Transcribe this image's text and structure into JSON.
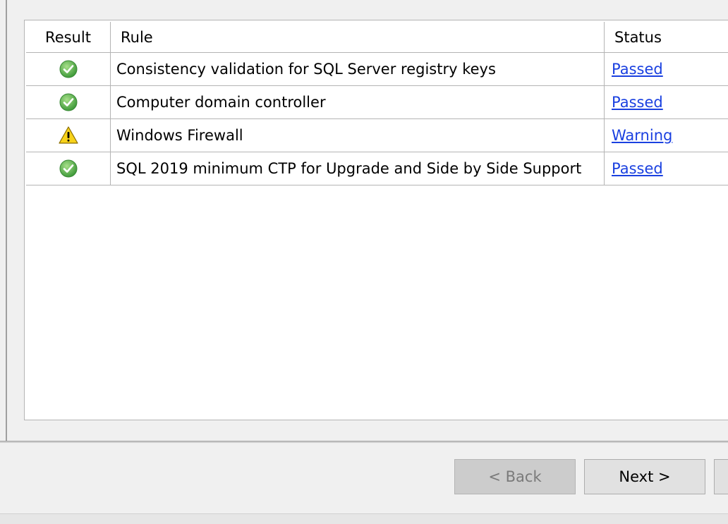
{
  "table": {
    "columns": {
      "result": "Result",
      "rule": "Rule",
      "status": "Status"
    },
    "rows": [
      {
        "result_icon": "check-icon",
        "rule": "Consistency validation for SQL Server registry keys",
        "status": "Passed"
      },
      {
        "result_icon": "check-icon",
        "rule": "Computer domain controller",
        "status": "Passed"
      },
      {
        "result_icon": "warning-icon",
        "rule": "Windows Firewall",
        "status": "Warning"
      },
      {
        "result_icon": "check-icon",
        "rule": "SQL 2019 minimum CTP for Upgrade and Side by Side Support",
        "status": "Passed"
      }
    ]
  },
  "buttons": {
    "back": "< Back",
    "next": "Next >"
  },
  "colors": {
    "link": "#1a40e0",
    "pass_green": "#5cb85c",
    "warning_yellow": "#f5d000"
  }
}
